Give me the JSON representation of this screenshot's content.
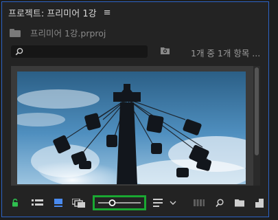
{
  "panel": {
    "title": "프로젝트: 프리미어 1강",
    "menu_glyph": "≡"
  },
  "project": {
    "filename": "프리미어 1강.prproj"
  },
  "search": {
    "placeholder": ""
  },
  "count_label": "1개 중 1개 항목 ...",
  "icons": {
    "lock": "lock-icon",
    "list_view": "list-view-icon",
    "icon_view": "icon-view-icon",
    "freeform": "freeform-view-icon",
    "sort": "sort-icon",
    "automate": "automate-to-sequence-icon",
    "find": "find-icon",
    "new_bin": "new-bin-icon",
    "new_item": "new-item-icon"
  },
  "zoom": {
    "level": 0.33
  },
  "colors": {
    "accent": "#2d64c8",
    "lock": "#2fbf4f",
    "highlight": "#1aa832",
    "active": "#4a8bf0"
  }
}
